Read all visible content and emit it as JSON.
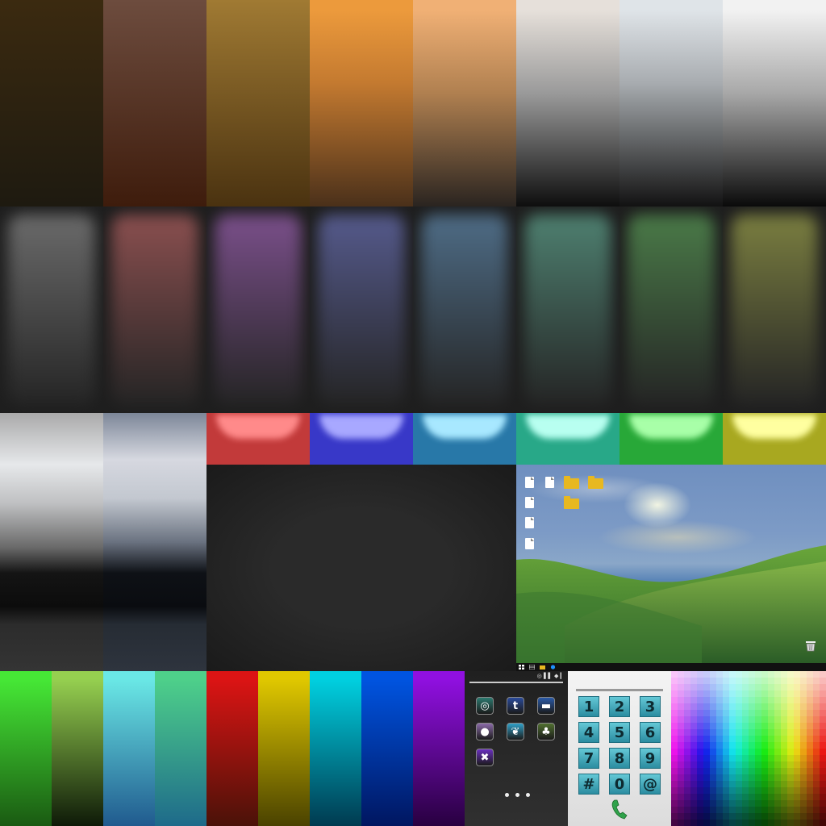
{
  "row1_colors": [
    [
      "#3b2a10",
      "#1e1a10"
    ],
    [
      "#6d4c3e",
      "#3e1c0c"
    ],
    [
      "#a07a33",
      "#4a3210"
    ],
    [
      "#ec9a3c",
      "#4a301a"
    ],
    [
      "#f0b075",
      "#2a2420"
    ],
    [
      "#e6e0da",
      "#0e0e0e"
    ],
    [
      "#dfe4e8",
      "#121212"
    ],
    [
      "#f2f2f2",
      "#0a0a0a"
    ]
  ],
  "glow_panels": [
    "#6a6a6a",
    "#8a4f4f",
    "#7a4f8a",
    "#555a8c",
    "#4e6c86",
    "#4e8070",
    "#4a7a48",
    "#7a7e40"
  ],
  "button_colors": [
    {
      "base": "#c23a3a",
      "hl": "#ff8a8a"
    },
    {
      "base": "#3838c8",
      "hl": "#a8a8ff"
    },
    {
      "base": "#2878a8",
      "hl": "#a8e8ff"
    },
    {
      "base": "#28a888",
      "hl": "#b8fff0"
    },
    {
      "base": "#28a838",
      "hl": "#a8ffa8"
    },
    {
      "base": "#a8a820",
      "hl": "#ffffa0"
    }
  ],
  "bottom_gradients": [
    [
      "#46e836",
      "#1a5a12"
    ],
    [
      "#96d050",
      "#0e1a08"
    ],
    [
      "#6ae8e6",
      "#205a8e"
    ],
    [
      "#4ed08a",
      "#1e6a8a"
    ],
    [
      "#dc1414",
      "#4a1208"
    ],
    [
      "#e0c800",
      "#4a4200"
    ],
    [
      "#00d0e0",
      "#003a50"
    ],
    [
      "#0054e0",
      "#001660"
    ],
    [
      "#9010e0",
      "#280040"
    ]
  ],
  "phone_home": {
    "status_text": "◎ ▌▌ ◆ ▎",
    "apps": [
      {
        "icon": "target-icon",
        "bg": "#2c7a70"
      },
      {
        "icon": "tumblr-icon",
        "label": "t",
        "bg": "#2a4a9a"
      },
      {
        "icon": "car-icon",
        "bg": "#2a5aa8"
      },
      {
        "icon": "ghost-icon",
        "bg": "#8a6aa8"
      },
      {
        "icon": "cat-icon",
        "bg": "#30a0c8"
      },
      {
        "icon": "palm-tree-icon",
        "bg": "#507030"
      },
      {
        "icon": "no-pin-icon",
        "bg": "#6a30c0"
      }
    ]
  },
  "dialer": {
    "keys": [
      "1",
      "2",
      "3",
      "4",
      "5",
      "6",
      "7",
      "8",
      "9",
      "#",
      "0",
      "@"
    ]
  }
}
